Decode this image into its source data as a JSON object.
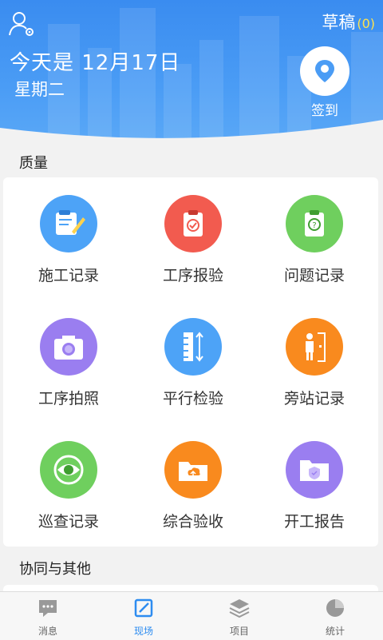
{
  "header": {
    "draft_label": "草稿",
    "draft_count": "(0)",
    "date": "今天是 12月17日",
    "weekday": "星期二",
    "checkin_label": "签到"
  },
  "sections": {
    "quality": "质量",
    "collab": "协同与其他"
  },
  "grid_items": [
    {
      "label": "施工记录",
      "icon": "construction-log-icon",
      "color": "#4da3f7"
    },
    {
      "label": "工序报验",
      "icon": "clipboard-check-icon",
      "color": "#f25b4f"
    },
    {
      "label": "问题记录",
      "icon": "question-clipboard-icon",
      "color": "#6fcf5e"
    },
    {
      "label": "工序拍照",
      "icon": "camera-icon",
      "color": "#9a7ef0"
    },
    {
      "label": "平行检验",
      "icon": "ruler-icon",
      "color": "#4da3f7"
    },
    {
      "label": "旁站记录",
      "icon": "person-door-icon",
      "color": "#f98a1e"
    },
    {
      "label": "巡查记录",
      "icon": "eye-icon",
      "color": "#6fcf5e"
    },
    {
      "label": "综合验收",
      "icon": "upload-folder-icon",
      "color": "#f98a1e"
    },
    {
      "label": "开工报告",
      "icon": "shield-folder-icon",
      "color": "#9a7ef0"
    }
  ],
  "tabs": [
    {
      "label": "消息",
      "icon": "message-icon",
      "active": false
    },
    {
      "label": "现场",
      "icon": "edit-icon",
      "active": true
    },
    {
      "label": "项目",
      "icon": "layers-icon",
      "active": false
    },
    {
      "label": "统计",
      "icon": "pie-chart-icon",
      "active": false
    }
  ],
  "colors": {
    "accent": "#2d8cf0",
    "header": "#4a9cf5",
    "draft_count": "#ffe34d"
  }
}
